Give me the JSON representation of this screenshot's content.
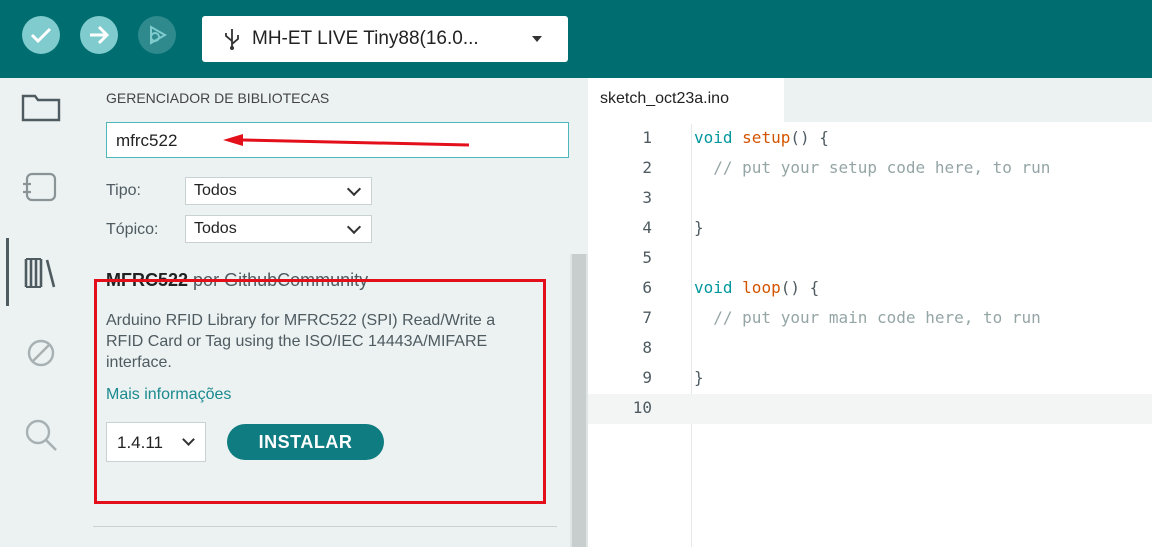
{
  "toolbar": {
    "verify_icon": "check-icon",
    "upload_icon": "arrow-right-icon",
    "debug_icon": "debug-icon",
    "board_icon": "usb-icon",
    "board_name": "MH-ET LIVE Tiny88(16.0...",
    "colors": {
      "bar": "#006d70",
      "button": "#7fcbcd"
    }
  },
  "sidebar": {
    "items": [
      {
        "icon": "folder-icon"
      },
      {
        "icon": "board-manager-icon"
      },
      {
        "icon": "library-icon",
        "active": true
      },
      {
        "icon": "debug-disabled-icon"
      },
      {
        "icon": "search-icon"
      }
    ]
  },
  "library": {
    "title": "GERENCIADOR DE BIBLIOTECAS",
    "search_value": "mfrc522",
    "filters": [
      {
        "label": "Tipo:",
        "value": "Todos"
      },
      {
        "label": "Tópico:",
        "value": "Todos"
      }
    ],
    "result": {
      "name": "MFRC522",
      "author": "por GithubCommunity",
      "description": "Arduino RFID Library for MFRC522 (SPI) Read/Write a RFID Card or Tag using the ISO/IEC 14443A/MIFARE interface.",
      "more_link": "Mais informações",
      "version": "1.4.11",
      "install_label": "INSTALAR"
    }
  },
  "editor": {
    "tab": "sketch_oct23a.ino",
    "lines": [
      {
        "n": "1",
        "kw": "void",
        "fn": "setup",
        "rest": "() {",
        "comment": "",
        "text": ""
      },
      {
        "n": "2",
        "kw": "",
        "fn": "",
        "rest": "",
        "comment": "  // put your setup code here, to run",
        "text": ""
      },
      {
        "n": "3",
        "kw": "",
        "fn": "",
        "rest": "",
        "comment": "",
        "text": ""
      },
      {
        "n": "4",
        "kw": "",
        "fn": "",
        "rest": "",
        "comment": "",
        "text": "}"
      },
      {
        "n": "5",
        "kw": "",
        "fn": "",
        "rest": "",
        "comment": "",
        "text": ""
      },
      {
        "n": "6",
        "kw": "void",
        "fn": "loop",
        "rest": "() {",
        "comment": "",
        "text": ""
      },
      {
        "n": "7",
        "kw": "",
        "fn": "",
        "rest": "",
        "comment": "  // put your main code here, to run",
        "text": ""
      },
      {
        "n": "8",
        "kw": "",
        "fn": "",
        "rest": "",
        "comment": "",
        "text": ""
      },
      {
        "n": "9",
        "kw": "",
        "fn": "",
        "rest": "",
        "comment": "",
        "text": "}"
      },
      {
        "n": "10",
        "kw": "",
        "fn": "",
        "rest": "",
        "comment": "",
        "text": ""
      }
    ]
  }
}
